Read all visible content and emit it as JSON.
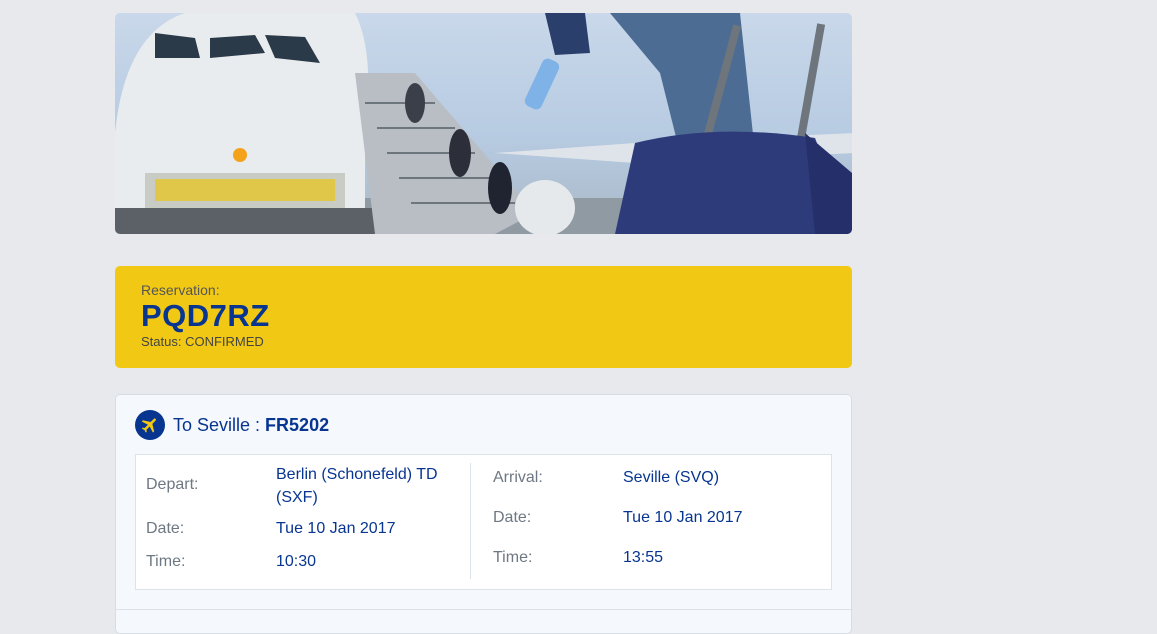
{
  "hero": {
    "image": "airport-boarding-photo"
  },
  "reservation": {
    "label": "Reservation:",
    "code": "PQD7RZ",
    "status": "Status: CONFIRMED"
  },
  "flight": {
    "icon": "plane-icon",
    "title_prefix": "To Seville : ",
    "flight_number": "FR5202",
    "depart": {
      "label": "Depart:",
      "value_line1": "Berlin (Schonefeld) TD",
      "value_line2": "(SXF)",
      "date_label": "Date:",
      "date": "Tue 10 Jan 2017",
      "time_label": "Time:",
      "time": "10:30"
    },
    "arrival": {
      "label": "Arrival:",
      "value": "Seville (SVQ)",
      "date_label": "Date:",
      "date": "Tue 10 Jan 2017",
      "time_label": "Time:",
      "time": "13:55"
    }
  },
  "colors": {
    "background": "#e7e9ed",
    "brand_blue": "#073590",
    "brand_yellow": "#f1c914"
  }
}
